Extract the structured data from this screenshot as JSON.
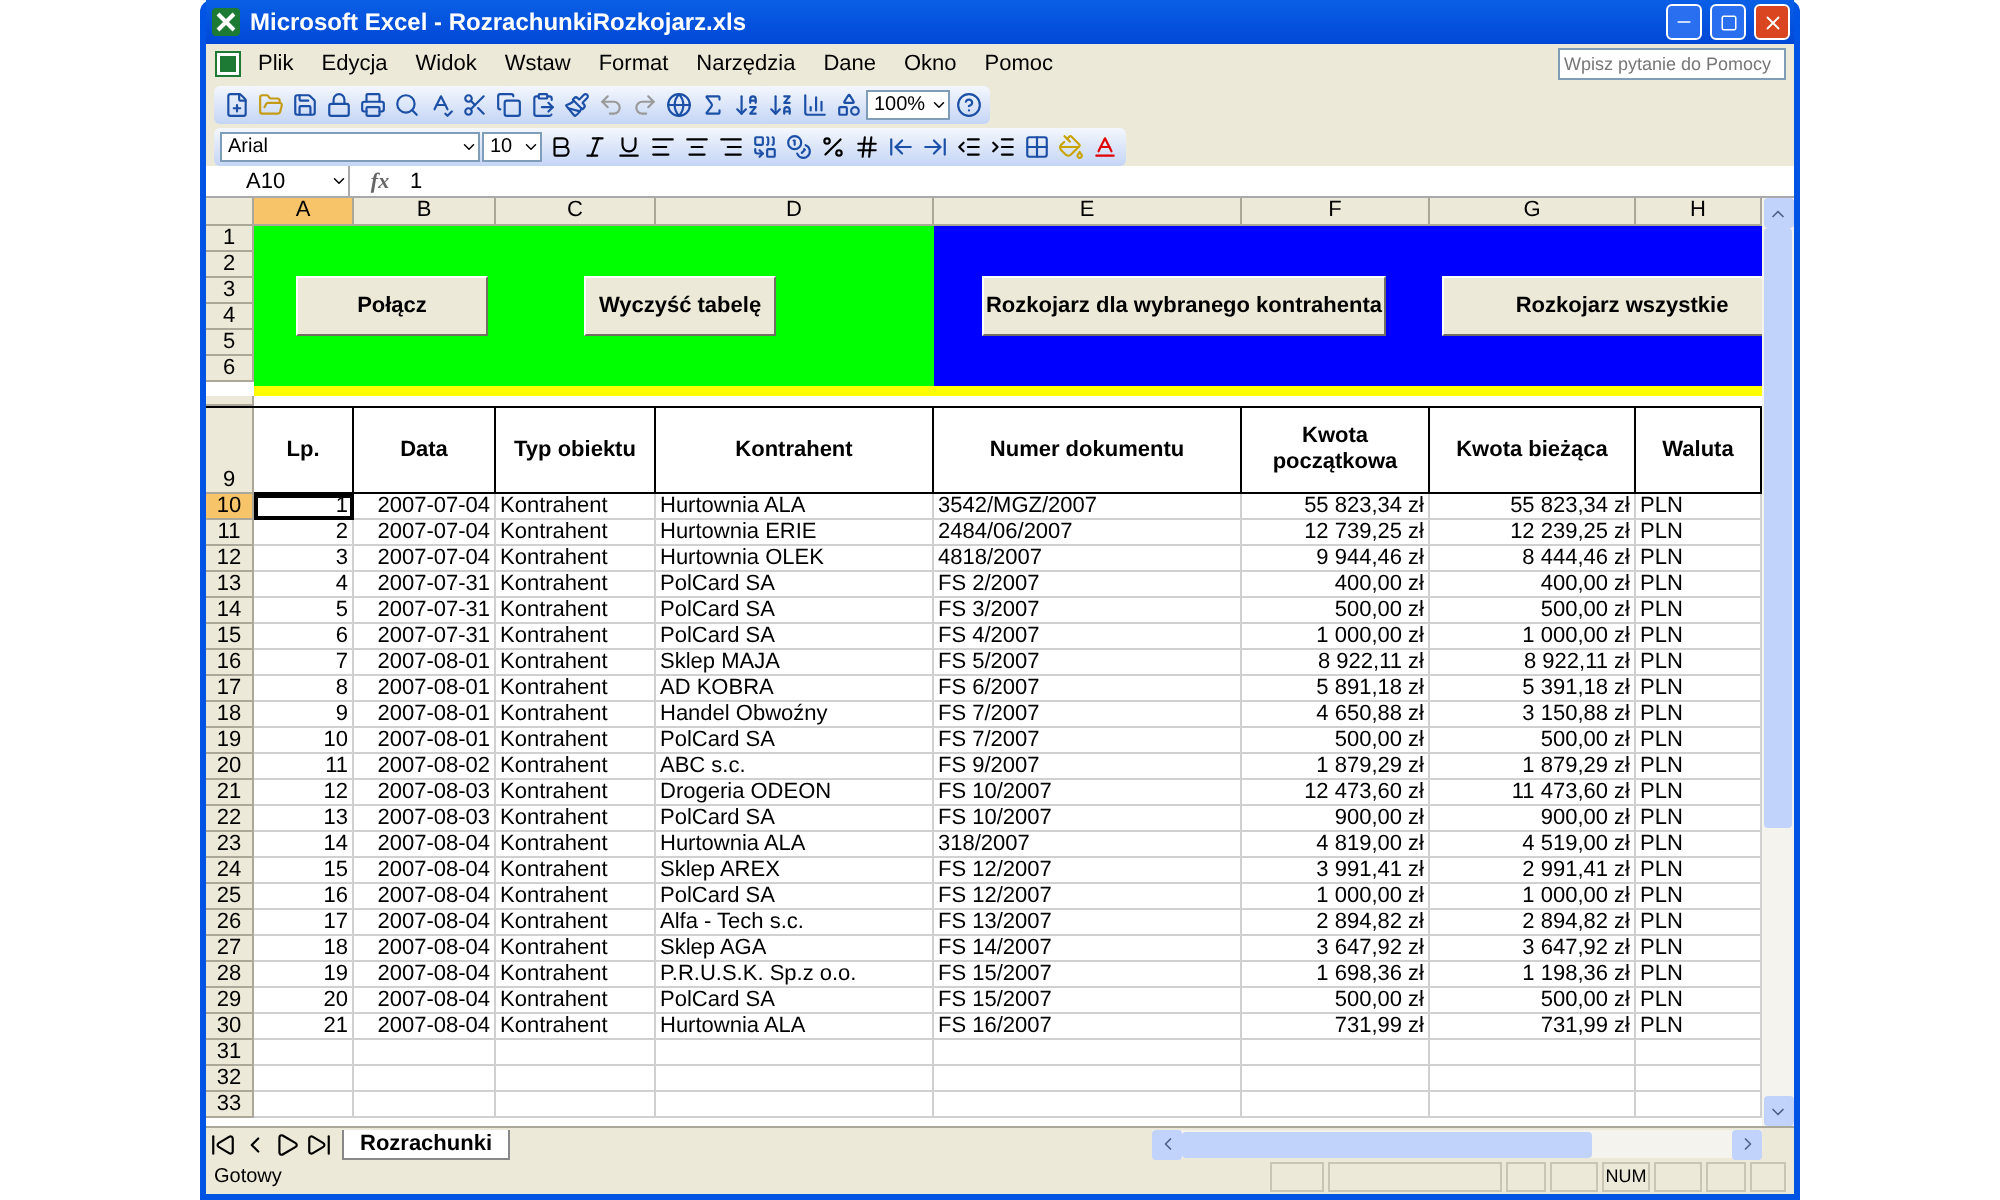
{
  "window": {
    "title": "Microsoft Excel - RozrachunkiRozkojarz.xls"
  },
  "menu": [
    "Plik",
    "Edycja",
    "Widok",
    "Wstaw",
    "Format",
    "Narzędzia",
    "Dane",
    "Okno",
    "Pomoc"
  ],
  "help_search": {
    "placeholder": "Wpisz pytanie do Pomocy"
  },
  "standard_toolbar": {
    "zoom": "100%"
  },
  "format_toolbar": {
    "font": "Arial",
    "size": "10"
  },
  "formula_bar": {
    "name_box": "A10",
    "fx_label": "fx",
    "value": "1"
  },
  "columns": [
    {
      "letter": "A",
      "selected": true
    },
    {
      "letter": "B",
      "selected": false
    },
    {
      "letter": "C",
      "selected": false
    },
    {
      "letter": "D",
      "selected": false
    },
    {
      "letter": "E",
      "selected": false
    },
    {
      "letter": "F",
      "selected": false
    },
    {
      "letter": "G",
      "selected": false
    },
    {
      "letter": "H",
      "selected": false
    }
  ],
  "top_row_numbers": [
    "1",
    "2",
    "3",
    "4",
    "5",
    "6"
  ],
  "panels": [
    {
      "color": "#00ff00",
      "buttons": [
        "Połącz",
        "Wyczyść tabelę"
      ]
    },
    {
      "color": "#0000ff",
      "buttons": [
        "Rozkojarz dla wybranego kontrahenta",
        "Rozkojarz wszystkie"
      ]
    }
  ],
  "header_row": {
    "number": "9",
    "cells": [
      "Lp.",
      "Data",
      "Typ obiektu",
      "Kontrahent",
      "Numer dokumentu",
      "Kwota początkowa",
      "Kwota bieżąca",
      "Waluta"
    ]
  },
  "rows": [
    {
      "number": "10",
      "selected": true,
      "cells": [
        "1",
        "2007-07-04",
        "Kontrahent",
        "Hurtownia ALA",
        "3542/MGZ/2007",
        "55 823,34 zł",
        "55 823,34 zł",
        "PLN"
      ]
    },
    {
      "number": "11",
      "selected": false,
      "cells": [
        "2",
        "2007-07-04",
        "Kontrahent",
        "Hurtownia ERIE",
        "2484/06/2007",
        "12 739,25 zł",
        "12 239,25 zł",
        "PLN"
      ]
    },
    {
      "number": "12",
      "selected": false,
      "cells": [
        "3",
        "2007-07-04",
        "Kontrahent",
        "Hurtownia OLEK",
        "4818/2007",
        "9 944,46 zł",
        "8 444,46 zł",
        "PLN"
      ]
    },
    {
      "number": "13",
      "selected": false,
      "cells": [
        "4",
        "2007-07-31",
        "Kontrahent",
        "PolCard SA",
        "FS 2/2007",
        "400,00 zł",
        "400,00 zł",
        "PLN"
      ]
    },
    {
      "number": "14",
      "selected": false,
      "cells": [
        "5",
        "2007-07-31",
        "Kontrahent",
        "PolCard SA",
        "FS 3/2007",
        "500,00 zł",
        "500,00 zł",
        "PLN"
      ]
    },
    {
      "number": "15",
      "selected": false,
      "cells": [
        "6",
        "2007-07-31",
        "Kontrahent",
        "PolCard SA",
        "FS 4/2007",
        "1 000,00 zł",
        "1 000,00 zł",
        "PLN"
      ]
    },
    {
      "number": "16",
      "selected": false,
      "cells": [
        "7",
        "2007-08-01",
        "Kontrahent",
        "Sklep MAJA",
        "FS 5/2007",
        "8 922,11 zł",
        "8 922,11 zł",
        "PLN"
      ]
    },
    {
      "number": "17",
      "selected": false,
      "cells": [
        "8",
        "2007-08-01",
        "Kontrahent",
        "AD KOBRA",
        "FS 6/2007",
        "5 891,18 zł",
        "5 391,18 zł",
        "PLN"
      ]
    },
    {
      "number": "18",
      "selected": false,
      "cells": [
        "9",
        "2007-08-01",
        "Kontrahent",
        "Handel Obwoźny",
        "FS 7/2007",
        "4 650,88 zł",
        "3 150,88 zł",
        "PLN"
      ]
    },
    {
      "number": "19",
      "selected": false,
      "cells": [
        "10",
        "2007-08-01",
        "Kontrahent",
        "PolCard SA",
        "FS 7/2007",
        "500,00 zł",
        "500,00 zł",
        "PLN"
      ]
    },
    {
      "number": "20",
      "selected": false,
      "cells": [
        "11",
        "2007-08-02",
        "Kontrahent",
        "ABC s.c.",
        "FS 9/2007",
        "1 879,29 zł",
        "1 879,29 zł",
        "PLN"
      ]
    },
    {
      "number": "21",
      "selected": false,
      "cells": [
        "12",
        "2007-08-03",
        "Kontrahent",
        "Drogeria ODEON",
        "FS 10/2007",
        "12 473,60 zł",
        "11 473,60 zł",
        "PLN"
      ]
    },
    {
      "number": "22",
      "selected": false,
      "cells": [
        "13",
        "2007-08-03",
        "Kontrahent",
        "PolCard SA",
        "FS 10/2007",
        "900,00 zł",
        "900,00 zł",
        "PLN"
      ]
    },
    {
      "number": "23",
      "selected": false,
      "cells": [
        "14",
        "2007-08-04",
        "Kontrahent",
        "Hurtownia ALA",
        "318/2007",
        "4 819,00 zł",
        "4 519,00 zł",
        "PLN"
      ]
    },
    {
      "number": "24",
      "selected": false,
      "cells": [
        "15",
        "2007-08-04",
        "Kontrahent",
        "Sklep AREX",
        "FS 12/2007",
        "3 991,41 zł",
        "2 991,41 zł",
        "PLN"
      ]
    },
    {
      "number": "25",
      "selected": false,
      "cells": [
        "16",
        "2007-08-04",
        "Kontrahent",
        "PolCard SA",
        "FS 12/2007",
        "1 000,00 zł",
        "1 000,00 zł",
        "PLN"
      ]
    },
    {
      "number": "26",
      "selected": false,
      "cells": [
        "17",
        "2007-08-04",
        "Kontrahent",
        "Alfa - Tech s.c.",
        "FS 13/2007",
        "2 894,82 zł",
        "2 894,82 zł",
        "PLN"
      ]
    },
    {
      "number": "27",
      "selected": false,
      "cells": [
        "18",
        "2007-08-04",
        "Kontrahent",
        "Sklep AGA",
        "FS 14/2007",
        "3 647,92 zł",
        "3 647,92 zł",
        "PLN"
      ]
    },
    {
      "number": "28",
      "selected": false,
      "cells": [
        "19",
        "2007-08-04",
        "Kontrahent",
        "P.R.U.S.K. Sp.z o.o.",
        "FS 15/2007",
        "1 698,36 zł",
        "1 198,36 zł",
        "PLN"
      ]
    },
    {
      "number": "29",
      "selected": false,
      "cells": [
        "20",
        "2007-08-04",
        "Kontrahent",
        "PolCard SA",
        "FS 15/2007",
        "500,00 zł",
        "500,00 zł",
        "PLN"
      ]
    },
    {
      "number": "30",
      "selected": false,
      "cells": [
        "21",
        "2007-08-04",
        "Kontrahent",
        "Hurtownia ALA",
        "FS 16/2007",
        "731,99 zł",
        "731,99 zł",
        "PLN"
      ]
    }
  ],
  "empty_rows": [
    "31",
    "32",
    "33"
  ],
  "sheet_tabs": [
    {
      "label": "Rozrachunki",
      "selected": true
    }
  ],
  "status_bar": {
    "text": "Gotowy",
    "num": "NUM"
  }
}
